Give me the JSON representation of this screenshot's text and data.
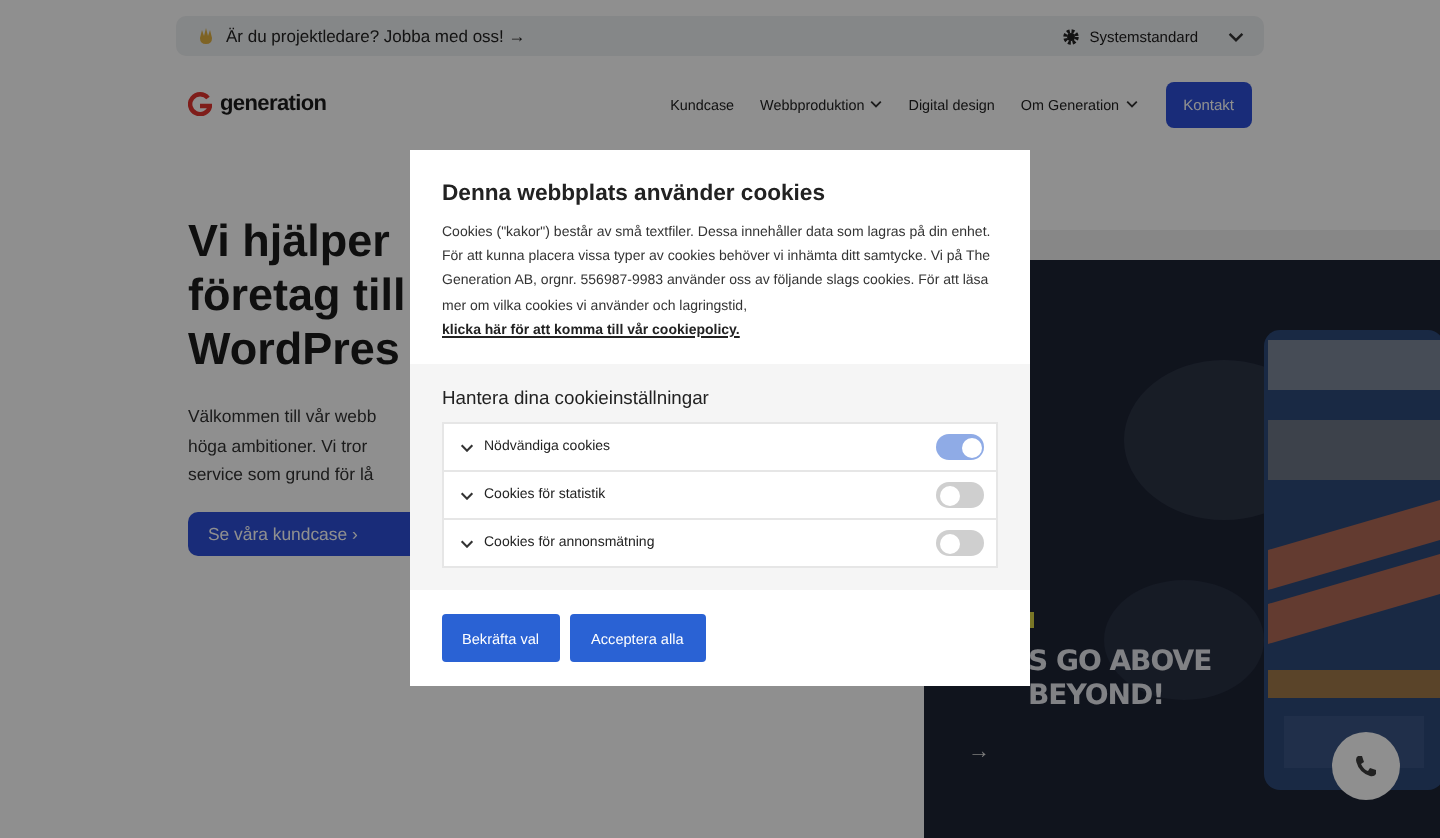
{
  "announcement": {
    "text": "Är du projektledare? Jobba med oss! →",
    "theme": "Systemstandard"
  },
  "nav": {
    "logo": "generation",
    "items": [
      {
        "label": "Kundcase",
        "dropdown": false
      },
      {
        "label": "Webbproduktion",
        "dropdown": true
      },
      {
        "label": "Digital design",
        "dropdown": false
      },
      {
        "label": "Om Generation",
        "dropdown": true
      }
    ],
    "cta": "Kontakt"
  },
  "hero": {
    "heading": [
      "Vi hjälper",
      "företag till",
      "WordPres"
    ],
    "intro": [
      "Välkommen till vår webb",
      "höga ambitioner. Vi tror",
      "service som grund för lå"
    ],
    "button": "Se våra kundcase ›"
  },
  "showcase": {
    "headline": [
      "S GO ABOVE",
      "BEYOND!"
    ],
    "arrow": "→"
  },
  "cookie_dialog": {
    "title": "Denna webbplats använder cookies",
    "text": "Cookies (\"kakor\") består av små textfiler. Dessa innehåller data som lagras på din enhet. För att kunna placera vissa typer av cookies behöver vi inhämta ditt samtycke. Vi på The Generation AB, orgnr. 556987-9983 använder oss av följande slags cookies. För att läsa mer om vilka cookies vi använder och lagringstid,",
    "link": "klicka här för att komma till vår cookiepolicy.",
    "settings_title": "Hantera dina cookieinställningar",
    "categories": [
      {
        "label": "Nödvändiga cookies",
        "on": true,
        "expanded": false
      },
      {
        "label": "Cookies för statistik",
        "on": false,
        "expanded": false
      },
      {
        "label": "Cookies för annonsmätning",
        "on": false,
        "expanded": false
      }
    ],
    "buttons": [
      "Bekräfta val",
      "Acceptera alla"
    ]
  }
}
